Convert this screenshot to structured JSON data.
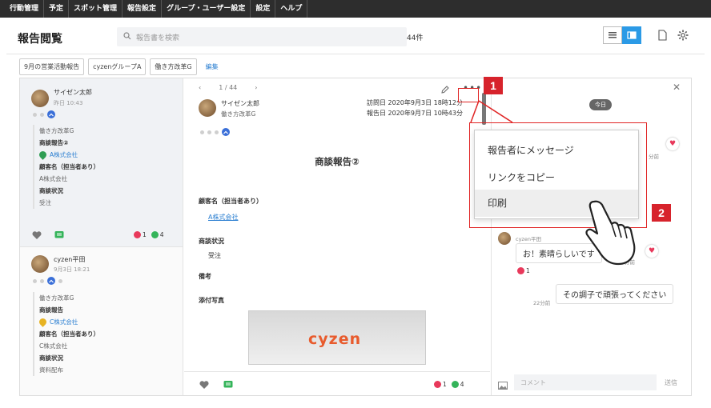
{
  "nav": [
    "行動管理",
    "予定",
    "スポット管理",
    "報告設定",
    "グループ・ユーザー設定",
    "設定",
    "ヘルプ"
  ],
  "header": {
    "title": "報告閲覧",
    "search_placeholder": "報告書を検索",
    "count": "44件"
  },
  "filters": {
    "chips": [
      "9月の営業活動報告",
      "cyzenグループA",
      "働き方改革G"
    ],
    "edit": "編集"
  },
  "list": [
    {
      "name": "サイゼン太郎",
      "time": "昨日 10:43",
      "team": "働き方改革G",
      "report": "商談報告②",
      "company": "A株式会社",
      "f1_label": "顧客名（担当者あり）",
      "f1_value": "A株式会社",
      "f2_label": "商談状況",
      "f2_value": "受注",
      "hearts": "1",
      "comments": "4"
    },
    {
      "name": "cyzen平田",
      "time": "9月3日 18:21",
      "team": "働き方改革G",
      "report": "商談報告",
      "company": "C株式会社",
      "f1_label": "顧客名（担当者あり）",
      "f1_value": "C株式会社",
      "f2_label": "商談状況",
      "f2_value": "資料配布"
    }
  ],
  "detail": {
    "pager": "1 / 44",
    "author": "サイゼン太郎",
    "team": "働き方改革G",
    "visit_date": "訪問日  2020年9月3日 18時12分",
    "report_date": "報告日  2020年9月7日 10時43分",
    "title": "商談報告②",
    "field1_label": "顧客名（担当者あり）",
    "field1_value": "A株式会社",
    "field2_label": "商談状況",
    "field2_value": "受注",
    "field3_label": "備考",
    "field4_label": "添付写真",
    "photo_text": "cyzen",
    "hearts": "1",
    "comments": "4"
  },
  "comments": {
    "today": "今日",
    "c1_time": "分前",
    "c2_name": "cyzen平田",
    "c2_text": "お！素晴らしいです",
    "c2_time": "分前",
    "c2_hearts": "1",
    "c3_text": "その調子で頑張ってください",
    "c3_time": "22分前",
    "input_placeholder": "コメント",
    "send": "送信"
  },
  "menu": {
    "items": [
      "報告者にメッセージ",
      "リンクをコピー",
      "印刷"
    ]
  },
  "callouts": {
    "m1": "1",
    "m2": "2"
  },
  "colors": {
    "accent": "#2b9ae6",
    "callout_red": "#d7232c",
    "heart": "#e8395b",
    "comment_green": "#34b45a"
  }
}
